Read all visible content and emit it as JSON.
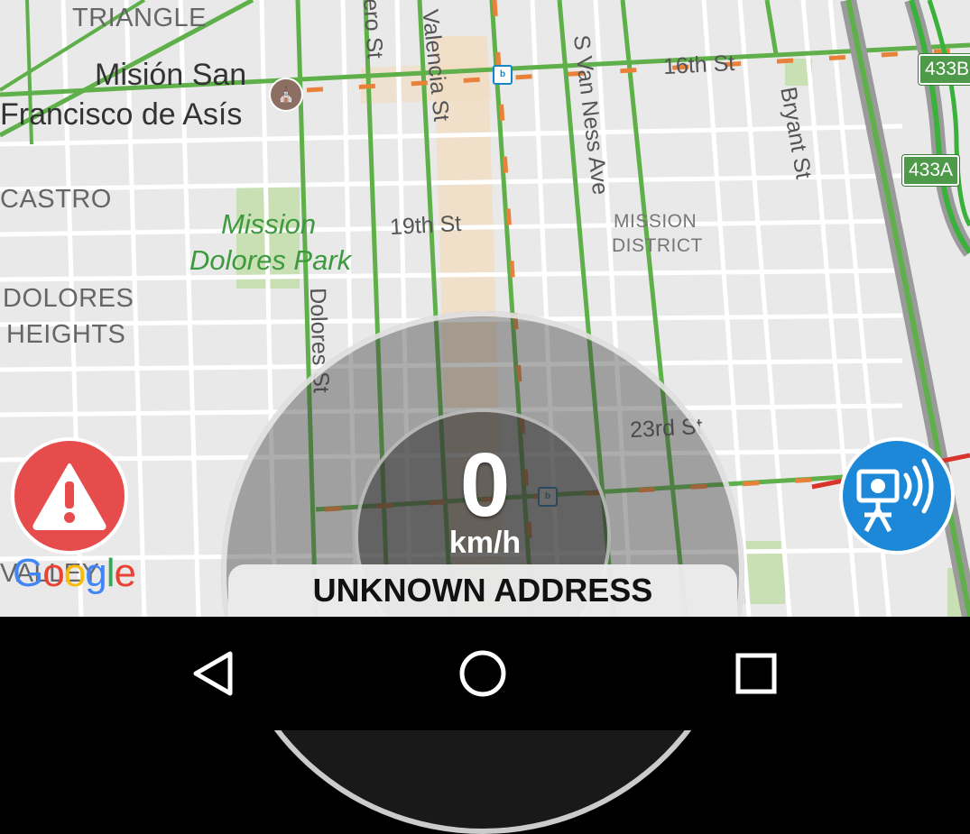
{
  "map": {
    "neighborhoods": {
      "triangle": "TRIANGLE",
      "castro": "CASTRO",
      "dolores_heights_1": "DOLORES",
      "dolores_heights_2": "HEIGHTS",
      "mission_district_1": "MISSION",
      "mission_district_2": "DISTRICT",
      "noe_partial": "VALLEY"
    },
    "places": {
      "mission_san_line1": "Misión San",
      "mission_san_line2": "Francisco de Asís",
      "park_line1": "Mission",
      "park_line2": "Dolores Park"
    },
    "streets": {
      "sixteenth": "16th St",
      "nineteenth": "19th St",
      "twentythird": "23rd St",
      "valencia": "Valencia St",
      "van_ness": "S Van Ness Ave",
      "bryant": "Bryant St",
      "dolores": "Dolores St",
      "guerrero_partial": "rero St"
    },
    "highway_exits": [
      "433B",
      "433A"
    ],
    "transit_badge": "b"
  },
  "speedometer": {
    "value": "0",
    "unit": "km/h"
  },
  "address": "UNKNOWN ADDRESS",
  "google_logo": {
    "letters": [
      "G",
      "o",
      "o",
      "g",
      "l",
      "e"
    ],
    "colors": [
      "#4285F4",
      "#EA4335",
      "#FBBC05",
      "#4285F4",
      "#34A853",
      "#EA4335"
    ]
  },
  "colors": {
    "alert_red": "#e74c4c",
    "camera_blue": "#1e88d8",
    "traffic_green": "#5fb04a",
    "traffic_orange": "#e8823a"
  },
  "icons": {
    "alert": "warning-triangle-icon",
    "camera": "speed-camera-icon",
    "back": "back-triangle-icon",
    "home": "home-circle-icon",
    "recents": "recents-square-icon"
  }
}
